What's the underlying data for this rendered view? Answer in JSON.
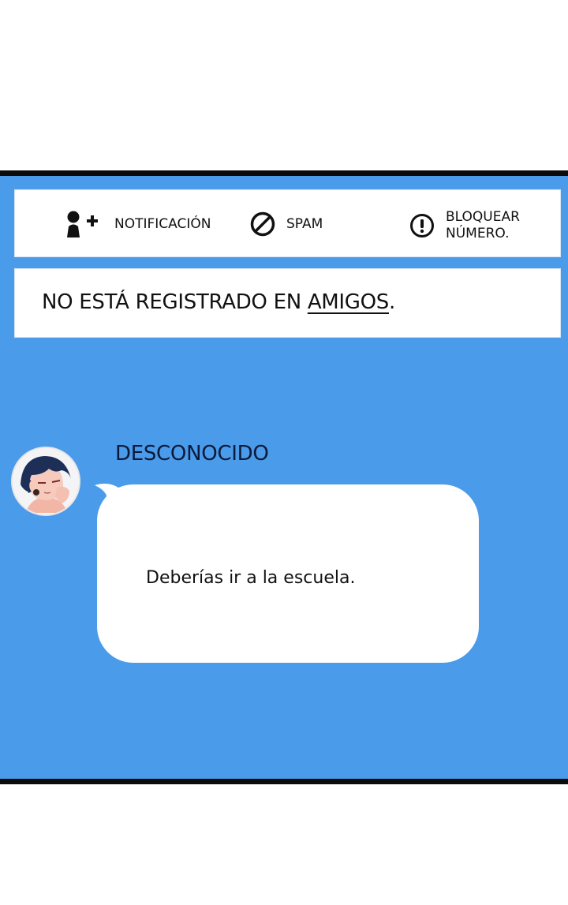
{
  "actions": {
    "notification": {
      "label": "NOTIFICACIÓN",
      "icon": "add-user-icon"
    },
    "spam": {
      "label": "SPAM",
      "icon": "block-icon"
    },
    "block": {
      "label": "BLOQUEAR\nNÚMERO.",
      "icon": "alert-circle-icon"
    }
  },
  "notice": {
    "prefix": "NO ESTÁ REGISTRADO EN ",
    "link": "AMIGOS",
    "suffix": "."
  },
  "message": {
    "sender": "DESCONOCIDO",
    "text": "Deberías ir a la escuela.",
    "avatar": "avatar-illustration"
  },
  "colors": {
    "panel_background": "#4a9bea",
    "card_background": "#ffffff",
    "border": "#0b0b0b",
    "text": "#111111"
  }
}
